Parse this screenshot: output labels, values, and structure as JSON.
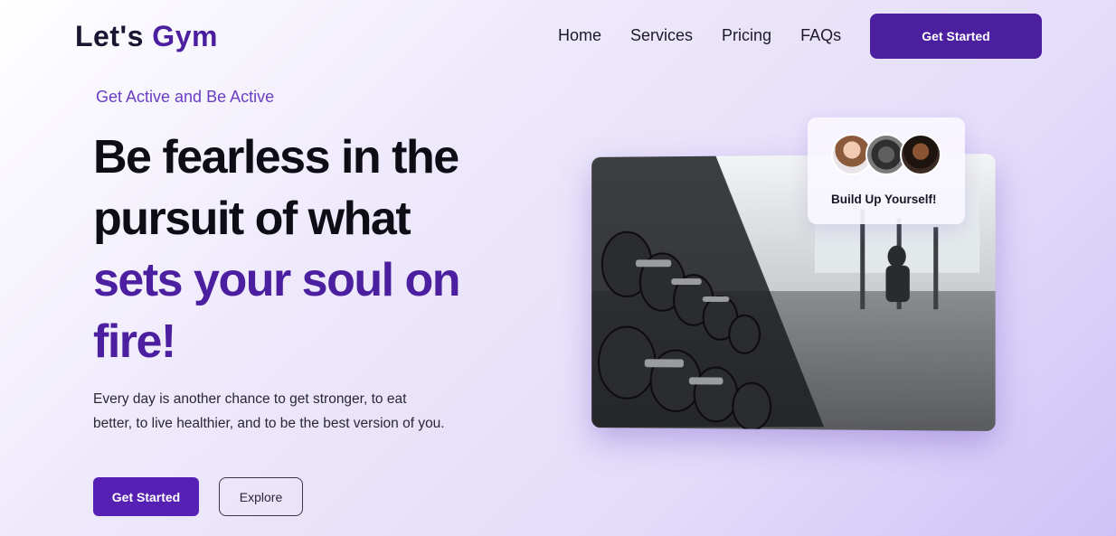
{
  "brand": {
    "part1": "Let's",
    "part2": "Gym"
  },
  "nav": {
    "items": [
      "Home",
      "Services",
      "Pricing",
      "FAQs"
    ],
    "cta": "Get Started"
  },
  "hero": {
    "tagline": "Get Active and Be Active",
    "headline_line1": "Be fearless in the",
    "headline_line2": "pursuit of what",
    "headline_accent": "sets your soul on fire!",
    "description": "Every day is another chance to get stronger, to eat better, to live healthier, and to be the best version of you.",
    "primary_button": "Get Started",
    "secondary_button": "Explore"
  },
  "card": {
    "label": "Build Up Yourself!"
  },
  "colors": {
    "accent": "#4b1fa0",
    "accent_light": "#6a3ec4"
  }
}
